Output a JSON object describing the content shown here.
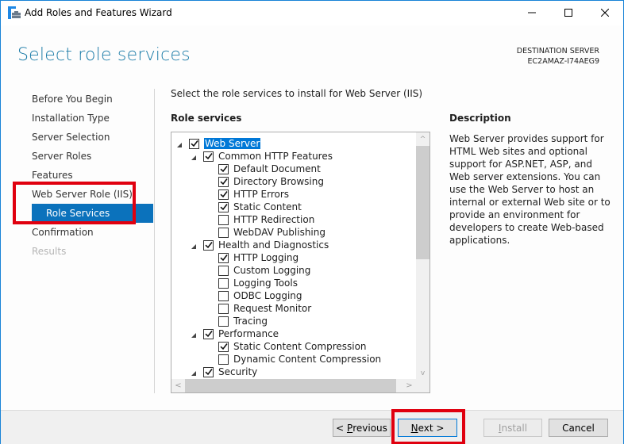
{
  "window": {
    "title": "Add Roles and Features Wizard",
    "app_icon": "server-manager-icon",
    "controls": {
      "minimize_icon": "minimize-icon",
      "maximize_icon": "maximize-icon",
      "close_icon": "close-icon"
    }
  },
  "header": {
    "page_title": "Select role services",
    "destination_label": "DESTINATION SERVER",
    "destination_server": "EC2AMAZ-I74AEG9"
  },
  "nav": {
    "items": [
      {
        "label": "Before You Begin",
        "state": "normal"
      },
      {
        "label": "Installation Type",
        "state": "normal"
      },
      {
        "label": "Server Selection",
        "state": "normal"
      },
      {
        "label": "Server Roles",
        "state": "normal"
      },
      {
        "label": "Features",
        "state": "normal"
      },
      {
        "label": "Web Server Role (IIS)",
        "state": "normal"
      },
      {
        "label": "Role Services",
        "state": "active"
      },
      {
        "label": "Confirmation",
        "state": "normal"
      },
      {
        "label": "Results",
        "state": "disabled"
      }
    ]
  },
  "main": {
    "instruction": "Select the role services to install for Web Server (IIS)",
    "role_services_label": "Role services",
    "tree": [
      {
        "label": "Web Server",
        "level": 0,
        "checked": true,
        "expanded": true,
        "selected": true
      },
      {
        "label": "Common HTTP Features",
        "level": 1,
        "checked": true,
        "expanded": true
      },
      {
        "label": "Default Document",
        "level": 2,
        "checked": true
      },
      {
        "label": "Directory Browsing",
        "level": 2,
        "checked": true
      },
      {
        "label": "HTTP Errors",
        "level": 2,
        "checked": true
      },
      {
        "label": "Static Content",
        "level": 2,
        "checked": true
      },
      {
        "label": "HTTP Redirection",
        "level": 2,
        "checked": false
      },
      {
        "label": "WebDAV Publishing",
        "level": 2,
        "checked": false
      },
      {
        "label": "Health and Diagnostics",
        "level": 1,
        "checked": true,
        "expanded": true
      },
      {
        "label": "HTTP Logging",
        "level": 2,
        "checked": true
      },
      {
        "label": "Custom Logging",
        "level": 2,
        "checked": false
      },
      {
        "label": "Logging Tools",
        "level": 2,
        "checked": false
      },
      {
        "label": "ODBC Logging",
        "level": 2,
        "checked": false
      },
      {
        "label": "Request Monitor",
        "level": 2,
        "checked": false
      },
      {
        "label": "Tracing",
        "level": 2,
        "checked": false
      },
      {
        "label": "Performance",
        "level": 1,
        "checked": true,
        "expanded": true
      },
      {
        "label": "Static Content Compression",
        "level": 2,
        "checked": true
      },
      {
        "label": "Dynamic Content Compression",
        "level": 2,
        "checked": false
      },
      {
        "label": "Security",
        "level": 1,
        "checked": true,
        "expanded": true
      }
    ],
    "scrollbar": {
      "up_arrow": "^",
      "down_arrow": "v",
      "left_arrow": "<",
      "right_arrow": ">"
    }
  },
  "description": {
    "label": "Description",
    "text": "Web Server provides support for HTML Web sites and optional support for ASP.NET, ASP, and Web server extensions. You can use the Web Server to host an internal or external Web site or to provide an environment for developers to create Web-based applications."
  },
  "footer": {
    "previous": {
      "prefix": "< ",
      "mnemonic": "P",
      "rest": "revious"
    },
    "next": {
      "mnemonic": "N",
      "rest": "ext >"
    },
    "install": {
      "mnemonic": "I",
      "rest": "nstall",
      "enabled": false
    },
    "cancel": "Cancel"
  },
  "highlights": {
    "color": "#e0000f",
    "targets": [
      "nav-web-server-role-and-role-services",
      "next-button"
    ]
  }
}
